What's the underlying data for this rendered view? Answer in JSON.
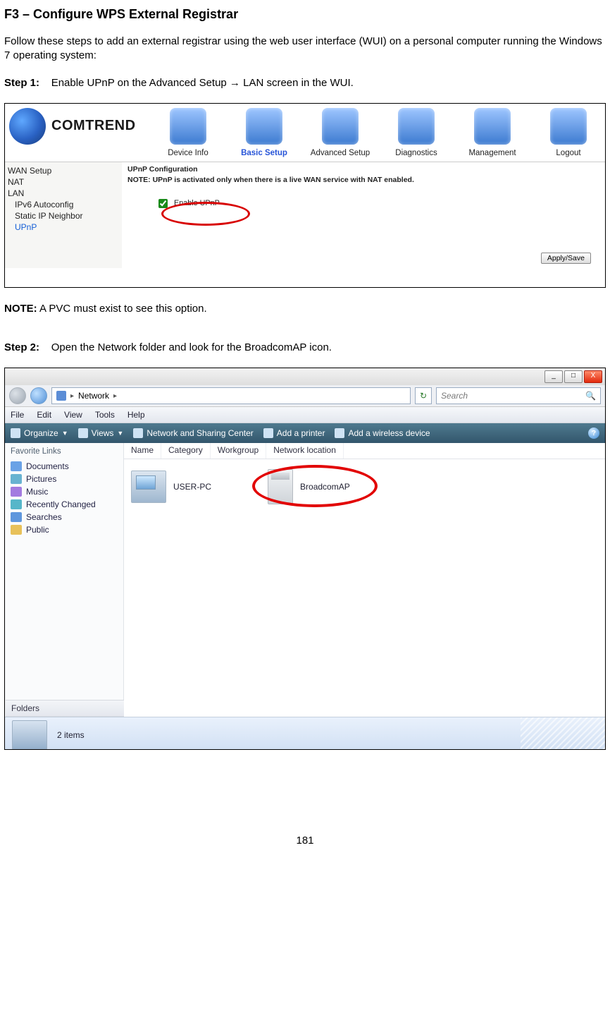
{
  "heading": "F3 – Configure WPS External Registrar",
  "intro": "Follow these steps to add an external registrar using the web user interface (WUI) on a personal computer running the Windows 7 operating system:",
  "step1": {
    "label": "Step 1:",
    "text": "Enable UPnP on the Advanced Setup → LAN screen in the WUI."
  },
  "note": {
    "label": "NOTE:",
    "text": " A PVC must exist to see this option."
  },
  "step2": {
    "label": "Step 2:",
    "text": "Open the Network folder and look for the BroadcomAP icon."
  },
  "page_number": "181",
  "wui": {
    "brand": "COMTREND",
    "icons": [
      {
        "label": "Device Info"
      },
      {
        "label": "Basic Setup",
        "active": true
      },
      {
        "label": "Advanced Setup"
      },
      {
        "label": "Diagnostics"
      },
      {
        "label": "Management"
      },
      {
        "label": "Logout"
      }
    ],
    "side": [
      {
        "label": "WAN Setup"
      },
      {
        "label": "NAT"
      },
      {
        "label": "LAN"
      },
      {
        "label": "IPv6 Autoconfig",
        "indent": true
      },
      {
        "label": "Static IP Neighbor",
        "indent": true
      },
      {
        "label": "UPnP",
        "indent": true,
        "active": true
      }
    ],
    "upnp_title": "UPnP Configuration",
    "upnp_note": "NOTE: UPnP is activated only when there is a live WAN service with NAT enabled.",
    "enable_label": "Enable UPnP",
    "apply": "Apply/Save"
  },
  "win": {
    "window_buttons": {
      "min": "_",
      "max": "□",
      "close": "X"
    },
    "address": {
      "text": "Network",
      "drop": "▸"
    },
    "search": {
      "placeholder": "Search",
      "mag": "🔍"
    },
    "menus": [
      "File",
      "Edit",
      "View",
      "Tools",
      "Help"
    ],
    "toolbar": {
      "organize": "Organize",
      "views": "Views",
      "nsc": "Network and Sharing Center",
      "addp": "Add a printer",
      "addw": "Add a wireless device"
    },
    "side_title": "Favorite Links",
    "side": [
      {
        "label": "Documents",
        "cls": "docs"
      },
      {
        "label": "Pictures",
        "cls": "pics"
      },
      {
        "label": "Music",
        "cls": "music"
      },
      {
        "label": "Recently Changed",
        "cls": "recent"
      },
      {
        "label": "Searches",
        "cls": "search"
      },
      {
        "label": "Public",
        "cls": "public"
      }
    ],
    "folders": "Folders",
    "folders_caret": "^",
    "columns": [
      "Name",
      "Category",
      "Workgroup",
      "Network location"
    ],
    "items": [
      {
        "label": "USER-PC",
        "type": "pc"
      },
      {
        "label": "BroadcomAP",
        "type": "ap",
        "highlight": true
      }
    ],
    "status": "2 items"
  }
}
